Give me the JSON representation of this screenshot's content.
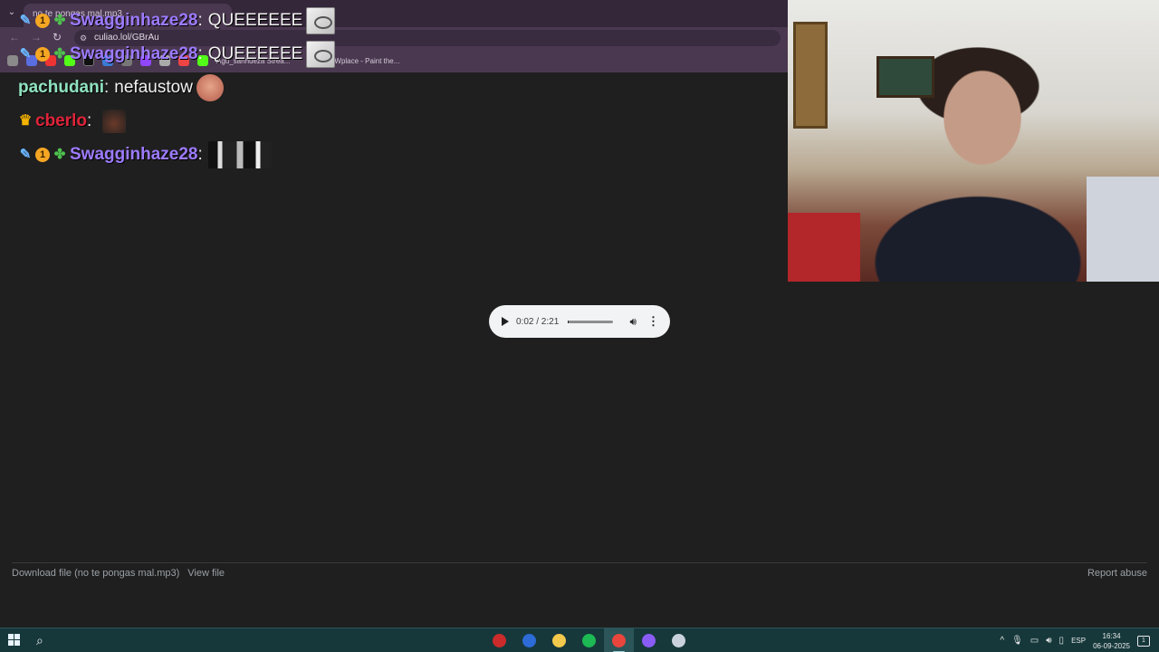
{
  "browser": {
    "tab_title": "no te pongas mal.mp3",
    "url": "culiao.lol/GBrAu",
    "bookmarks": [
      "Agu_sanhueza Strea...",
      "Wplace - Paint the..."
    ]
  },
  "chat": {
    "messages": [
      {
        "user": "Swagginhaze28",
        "color": "#9d7bff",
        "badges": [
          "sword-badge-icon",
          "one-badge-icon",
          "clover-badge-icon"
        ],
        "text": "QUEEEEEE",
        "emote": "frog"
      },
      {
        "user": "Swagginhaze28",
        "color": "#9d7bff",
        "badges": [
          "sword-badge-icon",
          "one-badge-icon",
          "clover-badge-icon"
        ],
        "text": "QUEEEEEE",
        "emote": "frog"
      },
      {
        "user": "pachudani",
        "color": "#8fe3c0",
        "badges": [],
        "text": "nefaustow",
        "emote": "face"
      },
      {
        "user": "cberlo",
        "color": "#e0243a",
        "badges": [
          "crown-badge-icon"
        ],
        "text": "",
        "emote": "dark"
      },
      {
        "user": "Swagginhaze28",
        "color": "#9d7bff",
        "badges": [
          "sword-badge-icon",
          "one-badge-icon",
          "clover-badge-icon"
        ],
        "text": "",
        "emote": "bw"
      }
    ]
  },
  "audio_player": {
    "time_display": "0:02 / 2:21",
    "progress": 0.015
  },
  "footer": {
    "download_label": "Download file (no te pongas mal.mp3)",
    "view_label": "View file",
    "report_label": "Report abuse"
  },
  "taskbar": {
    "language": "ESP",
    "time": "16:34",
    "date": "06-09-2025",
    "apps": [
      "app-icon",
      "store-icon",
      "file-explorer-icon",
      "spotify-icon",
      "chrome-icon",
      "discord-icon",
      "steam-icon"
    ],
    "app_colors": [
      "#cc2b2b",
      "#2d6bd6",
      "#f2c94c",
      "#1db954",
      "#e8453c",
      "#8a5cf6",
      "#c9d2dc"
    ]
  }
}
